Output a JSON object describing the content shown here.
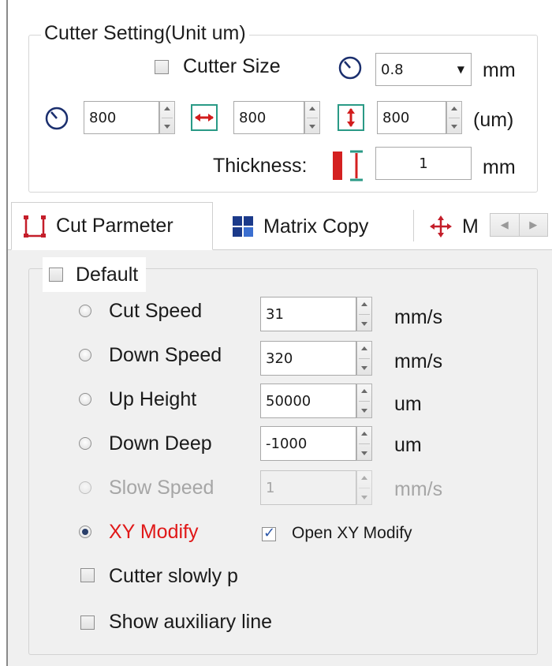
{
  "cutter_setting": {
    "title": "Cutter Setting(Unit um)",
    "cutter_size_label": "Cutter Size",
    "cutter_size_checked": false,
    "cutter_size_value": "0.8",
    "cutter_size_unit": "mm",
    "diameter_value": "800",
    "width_value": "800",
    "height_value": "800",
    "size_unit": "(um)",
    "thickness_label": "Thickness:",
    "thickness_value": "1",
    "thickness_unit": "mm"
  },
  "tabs": [
    {
      "label": "Cut Parmeter",
      "active": true,
      "icon": "cut-parameter-icon"
    },
    {
      "label": "Matrix Copy",
      "active": false,
      "icon": "matrix-copy-icon"
    },
    {
      "label": "M",
      "active": false,
      "icon": "move-icon"
    }
  ],
  "cut_parameter": {
    "default_label": "Default",
    "default_checked": false,
    "rows": [
      {
        "label": "Cut Speed",
        "value": "31",
        "unit": "mm/s",
        "selected": false,
        "enabled": true
      },
      {
        "label": "Down Speed",
        "value": "320",
        "unit": "mm/s",
        "selected": false,
        "enabled": true
      },
      {
        "label": "Up Height",
        "value": "50000",
        "unit": "um",
        "selected": false,
        "enabled": true
      },
      {
        "label": "Down Deep",
        "value": "-1000",
        "unit": "um",
        "selected": false,
        "enabled": true
      },
      {
        "label": "Slow Speed",
        "value": "1",
        "unit": "mm/s",
        "selected": false,
        "enabled": false
      }
    ],
    "xy_modify_label": "XY Modify",
    "xy_modify_selected": true,
    "open_xy_modify_label": "Open XY Modify",
    "open_xy_modify_checked": true,
    "cutter_slowly_label": "Cutter slowly p",
    "cutter_slowly_checked": false,
    "show_aux_line_label": "Show auxiliary line",
    "show_aux_line_checked": false
  },
  "colors": {
    "accent_red": "#e01818",
    "icon_navy": "#1b2f6e",
    "icon_teal": "#1a8a7a"
  }
}
